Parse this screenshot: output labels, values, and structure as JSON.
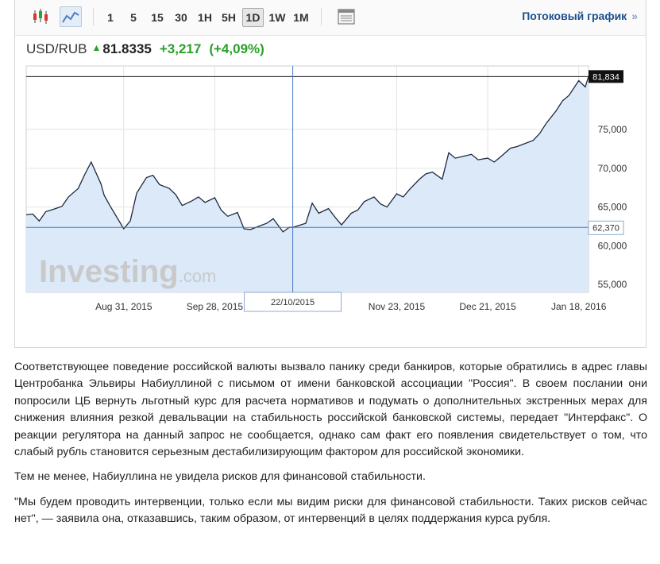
{
  "toolbar": {
    "ranges": [
      "1",
      "5",
      "15",
      "30",
      "1H",
      "5H",
      "1D",
      "1W",
      "1M"
    ],
    "active_range": "1D",
    "stream_label": "Потоковый график",
    "stream_arrow": "»"
  },
  "quote": {
    "symbol": "USD/RUB",
    "price": "81.8335",
    "change": "+3,217",
    "change_pct": "(+4,09%)",
    "colors": {
      "up": "#2aa02a"
    }
  },
  "chart": {
    "watermark": "Investing",
    "watermark_suffix": ".com",
    "last_label": "81,834",
    "cross_label": "62,370",
    "cross_date": "22/10/2015",
    "colors": {
      "line": "#1c2a3f",
      "fill": "#dbe9f9",
      "crosshair": "#4b79c2"
    }
  },
  "chart_data": {
    "type": "area",
    "title": "",
    "xlabel": "",
    "ylabel": "",
    "ylim": [
      54000,
      83200
    ],
    "xlim": [
      "2015-08-01",
      "2016-01-21"
    ],
    "y_ticks": [
      "55,000",
      "60,000",
      "65,000",
      "70,000",
      "75,000"
    ],
    "x_ticks": [
      {
        "label": "Aug 31, 2015",
        "date": "2015-08-31"
      },
      {
        "label": "Sep 28, 2015",
        "date": "2015-09-28"
      },
      {
        "label": "Nov 23, 2015",
        "date": "2015-11-23"
      },
      {
        "label": "Dec 21, 2015",
        "date": "2015-12-21"
      },
      {
        "label": "Jan 18, 2016",
        "date": "2016-01-18"
      }
    ],
    "last_value": 81834,
    "crosshair": {
      "date": "2015-10-22",
      "value": 62370
    },
    "grid": true,
    "series": [
      {
        "x": [
          "2015-08-01",
          "2015-08-03",
          "2015-08-05",
          "2015-08-07",
          "2015-08-10",
          "2015-08-12",
          "2015-08-14",
          "2015-08-17",
          "2015-08-19",
          "2015-08-21",
          "2015-08-24",
          "2015-08-25",
          "2015-08-27",
          "2015-08-31",
          "2015-09-02",
          "2015-09-04",
          "2015-09-07",
          "2015-09-09",
          "2015-09-11",
          "2015-09-14",
          "2015-09-16",
          "2015-09-18",
          "2015-09-21",
          "2015-09-23",
          "2015-09-25",
          "2015-09-28",
          "2015-09-30",
          "2015-10-02",
          "2015-10-05",
          "2015-10-07",
          "2015-10-09",
          "2015-10-12",
          "2015-10-14",
          "2015-10-16",
          "2015-10-19",
          "2015-10-21",
          "2015-10-22",
          "2015-10-26",
          "2015-10-28",
          "2015-10-30",
          "2015-11-02",
          "2015-11-04",
          "2015-11-06",
          "2015-11-09",
          "2015-11-11",
          "2015-11-13",
          "2015-11-16",
          "2015-11-18",
          "2015-11-20",
          "2015-11-23",
          "2015-11-25",
          "2015-11-27",
          "2015-11-30",
          "2015-12-02",
          "2015-12-04",
          "2015-12-07",
          "2015-12-09",
          "2015-12-11",
          "2015-12-14",
          "2015-12-16",
          "2015-12-18",
          "2015-12-21",
          "2015-12-23",
          "2015-12-25",
          "2015-12-28",
          "2015-12-30",
          "2016-01-04",
          "2016-01-06",
          "2016-01-08",
          "2016-01-11",
          "2016-01-13",
          "2016-01-15",
          "2016-01-18",
          "2016-01-20",
          "2016-01-21"
        ],
        "y": [
          64000,
          64100,
          63200,
          64400,
          64800,
          65100,
          66300,
          67400,
          69200,
          70800,
          68000,
          66500,
          65000,
          62200,
          63200,
          66800,
          68800,
          69100,
          67900,
          67400,
          66600,
          65200,
          65800,
          66300,
          65600,
          66200,
          64600,
          63800,
          64300,
          62200,
          62100,
          62600,
          62900,
          63500,
          61800,
          62400,
          62370,
          62900,
          65500,
          64200,
          64800,
          63700,
          62700,
          64200,
          64600,
          65700,
          66300,
          65400,
          65000,
          66700,
          66300,
          67300,
          68600,
          69300,
          69500,
          68600,
          72000,
          71300,
          71600,
          71800,
          71100,
          71300,
          70800,
          71500,
          72600,
          72800,
          73600,
          74500,
          75800,
          77400,
          78700,
          79400,
          81300,
          80500,
          81834
        ]
      }
    ]
  },
  "article": {
    "p1": "Соответствующее поведение российской валюты вызвало панику среди банкиров, которые обратились в адрес главы Центробанка Эльвиры Набиуллиной с письмом от имени банковской ассоциации \"Россия\". В своем послании они попросили ЦБ вернуть льготный курс для расчета нормативов и подумать о дополнительных экстренных мерах для снижения влияния резкой девальвации на стабильность российской банковской системы, передает \"Интерфакс\". О реакции регулятора на данный запрос не сообщается, однако сам факт его появления свидетельствует о том, что слабый рубль становится серьезным дестабилизирующим фактором для российской экономики.",
    "p2": "Тем не менее, Набиуллина не увидела рисков для финансовой стабильности.",
    "p3": "\"Мы будем проводить интервенции, только если мы видим риски для финансовой стабильности. Таких рисков сейчас нет\", — заявила она, отказавшись, таким образом, от интервенций в целях поддержания курса рубля."
  }
}
